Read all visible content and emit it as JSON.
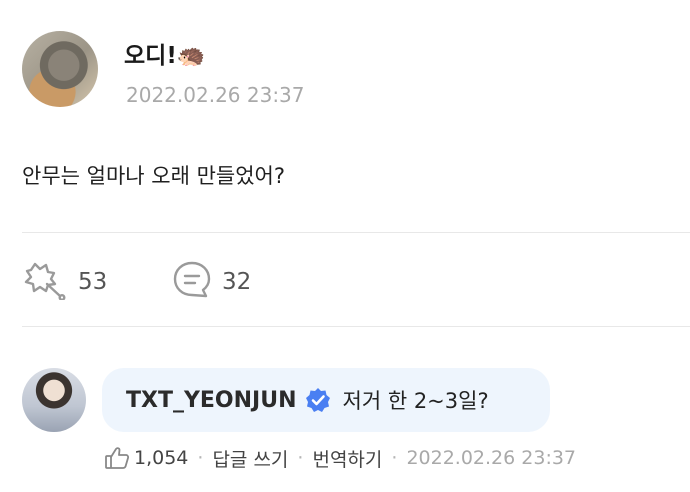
{
  "post": {
    "author_name": "오디!🦔",
    "date": "2022.02.26 23:37",
    "text": "안무는 얼마나 오래 만들었어?",
    "likes": "53",
    "comments": "32"
  },
  "reply": {
    "author": "TXT_YEONJUN",
    "text": "저거 한 2~3일?",
    "likes": "1,054",
    "reply_label": "답글 쓰기",
    "translate_label": "번역하기",
    "date": "2022.02.26 23:37"
  },
  "colors": {
    "verified_badge": "#4a7ff2",
    "bubble_bg": "#eef5fd",
    "muted_text": "#a9a9a9"
  }
}
